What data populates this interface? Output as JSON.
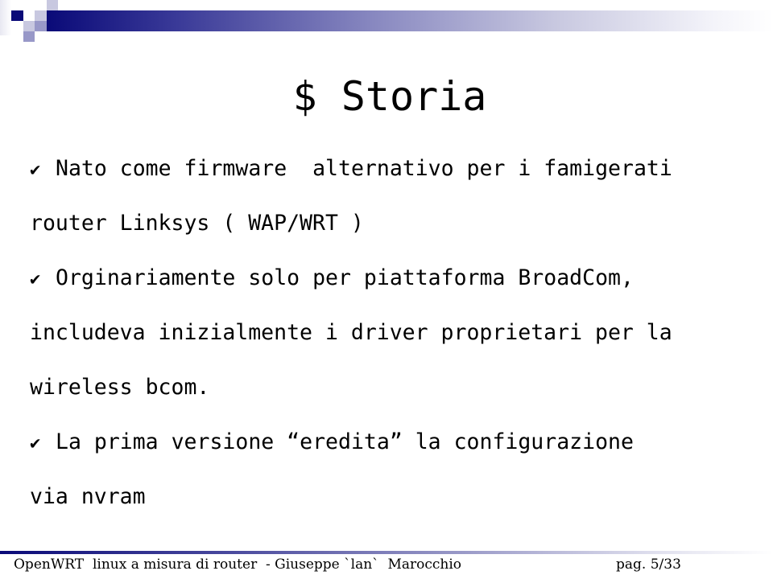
{
  "slide": {
    "title": "$ Storia",
    "bullet_icon": "✔",
    "lines": [
      {
        "bullet": true,
        "text": "Nato come firmware  alternativo per i famigerati"
      },
      {
        "bullet": false,
        "text": "router Linksys ( WAP/WRT )"
      },
      {
        "bullet": true,
        "text": "Orginariamente solo per piattaforma BroadCom,"
      },
      {
        "bullet": false,
        "text": "includeva inizialmente i driver proprietari per la"
      },
      {
        "bullet": false,
        "text": "wireless bcom."
      },
      {
        "bullet": true,
        "text": "La prima versione “eredita” la configurazione"
      },
      {
        "bullet": false,
        "text": "via nvram"
      }
    ]
  },
  "footer": {
    "left": "OpenWRT  linux a misura di router  - Giuseppe `lan`  Marocchio",
    "right": "pag. 5/33"
  },
  "colors": {
    "accent": "#0a0a78"
  }
}
